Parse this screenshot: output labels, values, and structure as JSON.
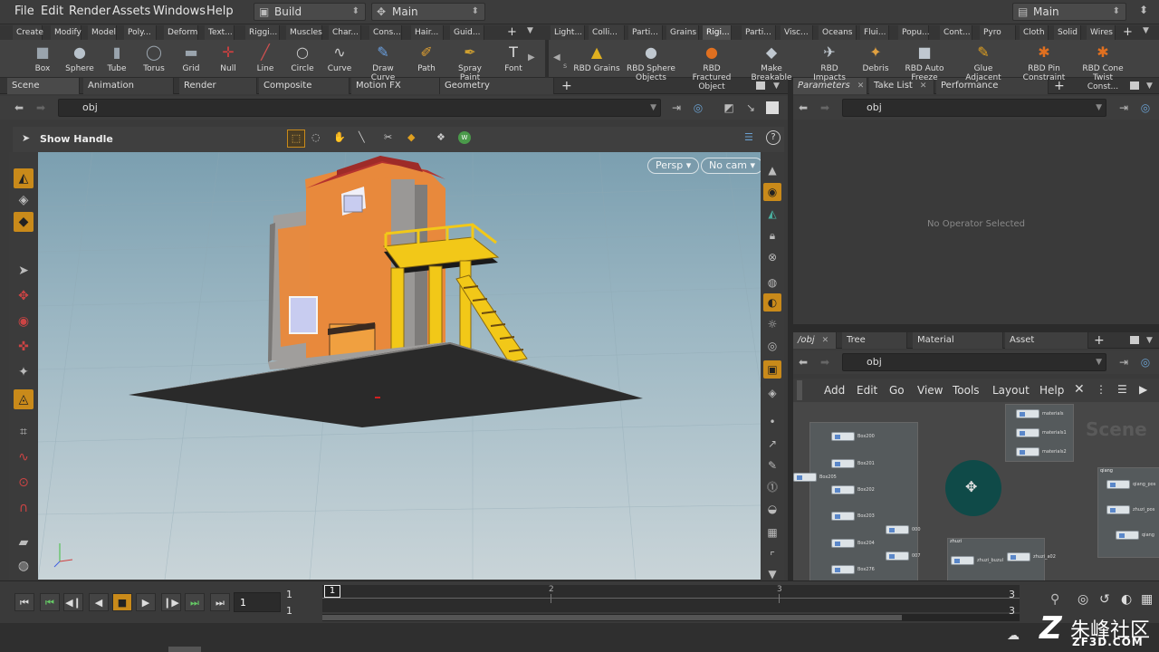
{
  "menubar": {
    "items": [
      "File",
      "Edit",
      "Render",
      "Assets",
      "Windows",
      "Help"
    ],
    "desktop_label": "Build",
    "desktop_arrow": "◆",
    "update_label": "Main",
    "right_desktop": "Main"
  },
  "shelf_tabs_left": [
    "Create",
    "Modify",
    "Model",
    "Poly...",
    "Deform",
    "Text...",
    "Riggi...",
    "Muscles",
    "Char...",
    "Cons...",
    "Hair...",
    "Guid..."
  ],
  "shelf_tabs_right": [
    "Light...",
    "Colli...",
    "Parti...",
    "Grains",
    "Rigi...",
    "Parti...",
    "Visc...",
    "Oceans",
    "Flui...",
    "Popu...",
    "Cont...",
    "Pyro FX",
    "Cloth",
    "Solid",
    "Wires"
  ],
  "tools_left": [
    {
      "label": "Box",
      "icon": "■",
      "color": "#9aa4ad"
    },
    {
      "label": "Sphere",
      "icon": "●",
      "color": "#b8c2cb"
    },
    {
      "label": "Tube",
      "icon": "▮",
      "color": "#9aa4ad"
    },
    {
      "label": "Torus",
      "icon": "◯",
      "color": "#9aa4ad"
    },
    {
      "label": "Grid",
      "icon": "▬",
      "color": "#9aa4ad"
    },
    {
      "label": "Null",
      "icon": "✛",
      "color": "#d04040"
    },
    {
      "label": "Line",
      "icon": "╱",
      "color": "#d05050"
    },
    {
      "label": "Circle",
      "icon": "○",
      "color": "#cccccc"
    },
    {
      "label": "Curve",
      "icon": "∿",
      "color": "#cccccc"
    },
    {
      "label": "Draw Curve",
      "icon": "✎",
      "color": "#6aa0e0"
    },
    {
      "label": "Path",
      "icon": "✐",
      "color": "#e0a030"
    },
    {
      "label": "Spray Paint",
      "icon": "✒",
      "color": "#d0a030"
    },
    {
      "label": "Font",
      "icon": "T",
      "color": "#dddddd"
    }
  ],
  "tools_right": [
    {
      "label": "RBD Grains",
      "icon": "▲",
      "color": "#e0b020"
    },
    {
      "label": "RBD Sphere Objects",
      "icon": "●",
      "color": "#c0c8d0"
    },
    {
      "label": "RBD Fractured Object",
      "icon": "●",
      "color": "#e07020"
    },
    {
      "label": "Make Breakable",
      "icon": "◆",
      "color": "#c0c8d0"
    },
    {
      "label": "RBD Impacts",
      "icon": "✈",
      "color": "#c0c8d0"
    },
    {
      "label": "Debris",
      "icon": "✦",
      "color": "#e0a040"
    },
    {
      "label": "RBD Auto Freeze",
      "icon": "■",
      "color": "#c0c8d0"
    },
    {
      "label": "Glue Adjacent",
      "icon": "✎",
      "color": "#e0a020"
    },
    {
      "label": "RBD Pin Constraint",
      "icon": "✱",
      "color": "#e07020"
    },
    {
      "label": "RBD Cone Twist Const...",
      "icon": "✱",
      "color": "#e07020"
    }
  ],
  "left_pane": {
    "tabs": [
      "Scene View",
      "Animation Editor",
      "Render View",
      "Composite View",
      "Motion FX View",
      "Geometry Spreadsheet"
    ],
    "path": "obj",
    "handle_label": "Show Handle",
    "persp_label": "Persp",
    "cam_label": "No cam"
  },
  "params_pane": {
    "tabs": [
      "Parameters",
      "Take List",
      "Performance Monitor"
    ],
    "path": "obj",
    "empty_message": "No Operator Selected"
  },
  "network_pane": {
    "tabs": [
      "/obj",
      "Tree View",
      "Material Palette",
      "Asset Browser"
    ],
    "path": "obj",
    "menu": [
      "Add",
      "Edit",
      "Go",
      "View",
      "Tools",
      "Layout",
      "Help"
    ],
    "watermark": "Scene",
    "nodes_left": [
      "Box200",
      "Box201",
      "Box202",
      "Box203",
      "Box204",
      "Box276"
    ],
    "lone_node": "Box205",
    "mid_nodes": [
      "000",
      "007"
    ],
    "material_nodes": [
      "materials",
      "materials1",
      "materials2"
    ],
    "group_zhuzi": {
      "title": "zhuzi",
      "nodes": [
        "zhuzi_buzul",
        "zhuzi_a02"
      ]
    },
    "group_qiang": {
      "title": "qiang",
      "nodes": [
        "qiang_pos",
        "zhuzi_pos",
        "qiang"
      ]
    }
  },
  "timeline": {
    "current_frame": "1",
    "start_a": "1",
    "start_b": "1",
    "end_a": "3",
    "end_b": "3",
    "ticks": [
      "1",
      "2",
      "3"
    ]
  },
  "watermark": {
    "main": "朱峰社区",
    "url": "ZF3D.COM"
  }
}
